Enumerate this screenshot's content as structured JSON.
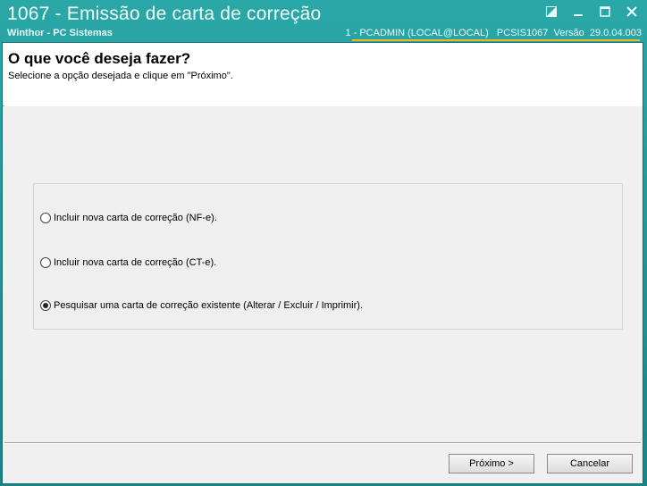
{
  "window": {
    "title": "1067 - Emissão de carta de correção",
    "subtitle": "Winthor - PC Sistemas",
    "info": "1 - PCADMIN (LOCAL@LOCAL)   PCSIS1067  Versão  29.0.04.003"
  },
  "header": {
    "title": "O que você deseja fazer?",
    "subtitle": "Selecione a opção desejada e clique em \"Próximo\"."
  },
  "options": [
    {
      "label": "Incluir nova carta de correção (NF-e).",
      "checked": false
    },
    {
      "label": "Incluir nova carta de correção (CT-e).",
      "checked": false
    },
    {
      "label": "Pesquisar uma carta de correção existente (Alterar / Excluir / Imprimir).",
      "checked": true
    }
  ],
  "buttons": {
    "next": "Próximo >",
    "cancel": "Cancelar"
  },
  "colors": {
    "titlebar": "#1d8f8f",
    "accent_underline": "#f0b81a"
  }
}
